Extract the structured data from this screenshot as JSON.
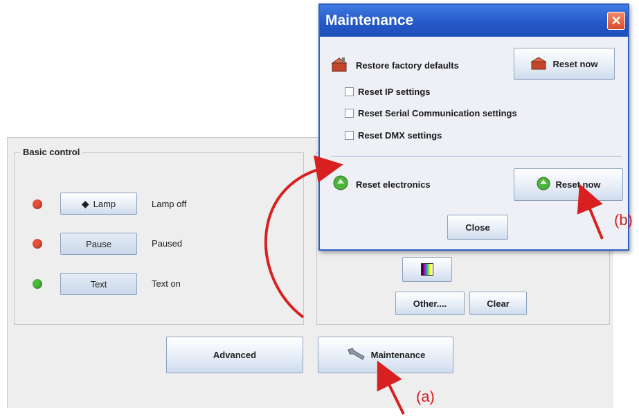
{
  "basic_control": {
    "title": "Basic control",
    "rows": [
      {
        "button": "Lamp",
        "status": "Lamp off",
        "led_color": "#e8503a"
      },
      {
        "button": "Pause",
        "status": "Paused",
        "led_color": "#e8503a"
      },
      {
        "button": "Text",
        "status": "Text on",
        "led_color": "#4cba3c"
      }
    ]
  },
  "right_panel": {
    "other_label": "Other....",
    "clear_label": "Clear"
  },
  "bottom": {
    "advanced_label": "Advanced",
    "maintenance_label": "Maintenance"
  },
  "dialog": {
    "title": "Maintenance",
    "restore_label": "Restore factory defaults",
    "reset_now_label": "Reset now",
    "checkboxes": [
      "Reset IP settings",
      "Reset Serial Communication settings",
      "Reset DMX settings"
    ],
    "electronics_label": "Reset electronics",
    "reset_now_label_2": "Reset now",
    "close_label": "Close"
  },
  "annotations": {
    "a": "(a)",
    "b": "(b)"
  },
  "colors": {
    "title_bar": "#2558c9",
    "arrow": "#d82020"
  }
}
